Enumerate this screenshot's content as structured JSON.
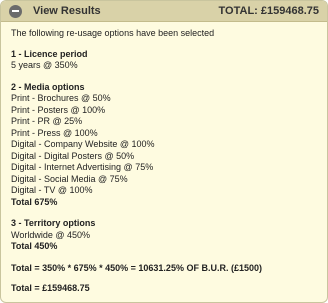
{
  "header": {
    "title": "View Results",
    "total": "TOTAL: £159468.75"
  },
  "intro": "The following re-usage options have been selected",
  "licence": {
    "title": "1 - Licence period",
    "value": "5 years @ 350%"
  },
  "media": {
    "title": "2 - Media options",
    "items": [
      "Print - Brochures @ 50%",
      "Print - Posters @ 100%",
      "Print - PR @ 25%",
      "Print - Press @ 100%",
      "Digital - Company Website @ 100%",
      "Digital - Digital Posters @ 50%",
      "Digital - Internet Advertising @ 75%",
      "Digital - Social Media @ 75%",
      "Digital - TV @ 100%"
    ],
    "total": "Total  675%"
  },
  "territory": {
    "title": "3 - Territory options",
    "value": "Worldwide @ 450%",
    "total": "Total  450%"
  },
  "calculation": "Total = 350% * 675% * 450% = 10631.25% OF B.U.R. (£1500)",
  "final_total": "Total = £159468.75"
}
